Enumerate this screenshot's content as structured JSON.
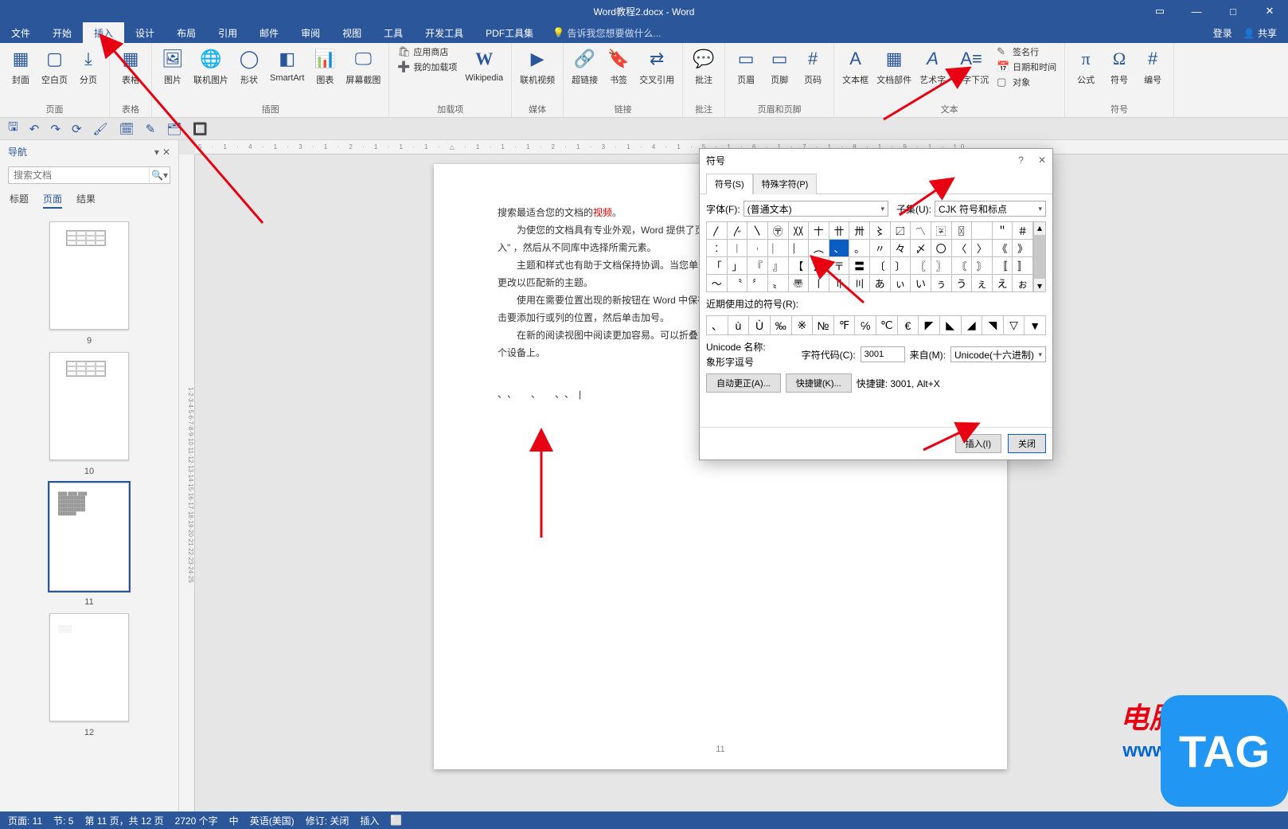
{
  "app": {
    "title": "Word教程2.docx - Word"
  },
  "win_ctrl": {
    "ribbon_opts": "▭",
    "min": "—",
    "max": "□",
    "close": "✕"
  },
  "menu": {
    "tabs": [
      "文件",
      "开始",
      "插入",
      "设计",
      "布局",
      "引用",
      "邮件",
      "审阅",
      "视图",
      "工具",
      "开发工具",
      "PDF工具集"
    ],
    "active": 2,
    "tellme": "告诉我您想要做什么...",
    "tellme_icon": "💡",
    "login": "登录",
    "share": "共享"
  },
  "ribbon": {
    "groups": [
      {
        "label": "页面",
        "buttons": [
          "封面",
          "空白页",
          "分页"
        ]
      },
      {
        "label": "表格",
        "buttons": [
          "表格"
        ]
      },
      {
        "label": "插图",
        "buttons": [
          "图片",
          "联机图片",
          "形状",
          "SmartArt",
          "图表",
          "屏幕截图"
        ]
      },
      {
        "label": "加载项",
        "small": [
          "应用商店",
          "我的加载项"
        ],
        "buttons": [
          "Wikipedia"
        ]
      },
      {
        "label": "媒体",
        "buttons": [
          "联机视频"
        ]
      },
      {
        "label": "链接",
        "buttons": [
          "超链接",
          "书签",
          "交叉引用"
        ]
      },
      {
        "label": "批注",
        "buttons": [
          "批注"
        ]
      },
      {
        "label": "页眉和页脚",
        "buttons": [
          "页眉",
          "页脚",
          "页码"
        ]
      },
      {
        "label": "文本",
        "buttons": [
          "文本框",
          "文档部件",
          "艺术字",
          "首字下沉"
        ],
        "small": [
          "签名行",
          "日期和时间",
          "对象"
        ]
      },
      {
        "label": "符号",
        "buttons": [
          "公式",
          "符号",
          "编号"
        ]
      }
    ]
  },
  "qat": [
    "🖫",
    "↶",
    "↷",
    "⟳",
    "🖌",
    "🗓",
    "✎",
    "🗂",
    "🔲"
  ],
  "nav": {
    "title": "导航",
    "search_placeholder": "搜索文档",
    "tabs": [
      "标题",
      "页面",
      "结果"
    ],
    "active_tab": 1,
    "pages": [
      "9",
      "10",
      "11",
      "12"
    ],
    "selected": 2
  },
  "doc": {
    "l1a": "搜索最适合您的文档的",
    "l1b": "视频",
    "l1c": "。",
    "p1": "为使您的文档具有专业外观，Word 提供了页眉、这些设计可互为补充。例如，您可以添加匹配的封面入\" ，然后从不同库中选择所需元素。",
    "p2": "主题和样式也有助于文档保持协调。当您单击设图表或 SmartArt 图形将会更改以匹配新的主题。当行更改以匹配新的主题。",
    "p3": "使用在需要位置出现的新按钮在 Word 中保存时档的方式，请单击该图片，图片旁边将会显示布局选击要添加行或列的位置，然后单击加号。",
    "p4": "在新的阅读视图中阅读更加容易。可以折叠文档如果在达到结尾处之前需要停止读取，Word 会记住一个设备上。",
    "inserted": "、、　、　、、",
    "cursor": "|",
    "pagenum": "11"
  },
  "rulerh_text": "5 · 1 · 4 · 1 · 3 · 1 · 2 · 1 · 1 · 1 · △ · 1 · 1 · 1 · 2 · 1 · 3 · 1 · 4 · 1 · 5 · 1 · 6 · 1 · 7 · 1 · 8 · 1 · 9 · 1 · 10",
  "dialog": {
    "title": "符号",
    "help": "?",
    "close": "✕",
    "tabs": [
      "符号(S)",
      "特殊字符(P)"
    ],
    "active_tab": 0,
    "font_label": "字体(F):",
    "font_value": "(普通文本)",
    "subset_label": "子集(U):",
    "subset_value": "CJK 符号和标点",
    "grid": [
      "〳",
      "〴",
      "〵",
      "〶",
      "〷",
      "〸",
      "〹",
      "〺",
      "〻",
      "〼",
      "〽",
      "〾",
      "〿",
      "぀",
      "＂",
      "＃",
      "︰",
      "︱",
      "︲",
      "︳",
      "︴",
      "︵",
      "、",
      "。",
      "〃",
      "々",
      "〆",
      "〇",
      "〈",
      "〉",
      "《",
      "》",
      "「",
      "」",
      "『",
      "』",
      "【",
      "】",
      "〒",
      "〓",
      "〔",
      "〕",
      "〖",
      "〗",
      "〘",
      "〙",
      "〚",
      "〛",
      "〜",
      "〝",
      "〞",
      "〟",
      "〠",
      "〡",
      "〢",
      "〣",
      "あ",
      "ぃ",
      "い",
      "ぅ",
      "う",
      "ぇ",
      "え",
      "ぉ"
    ],
    "selected_index": 22,
    "recent_label": "近期使用过的符号(R):",
    "recent": [
      "、",
      "ù",
      "Ù",
      "‰",
      "※",
      "№",
      "℉",
      "℅",
      "℃",
      "€",
      "◤",
      "◣",
      "◢",
      "◥",
      "▽",
      "▼"
    ],
    "uname_label": "Unicode 名称:",
    "uname_value": "象形字逗号",
    "code_label": "字符代码(C):",
    "code_value": "3001",
    "from_label": "来自(M):",
    "from_value": "Unicode(十六进制)",
    "autocorrect": "自动更正(A)...",
    "shortcut": "快捷键(K)...",
    "shortcut_info": "快捷键: 3001, Alt+X",
    "insert": "插入(I)",
    "close_btn": "关闭"
  },
  "status": {
    "items": [
      "页面: 11",
      "节: 5",
      "第 11 页，共 12 页",
      "2720 个字",
      "中",
      "英语(美国)",
      "修订: 关闭",
      "插入",
      "⬜"
    ]
  },
  "wm": {
    "line1": "电脑技术网",
    "line2": "www.tagxp.com",
    "tag": "TAG"
  }
}
